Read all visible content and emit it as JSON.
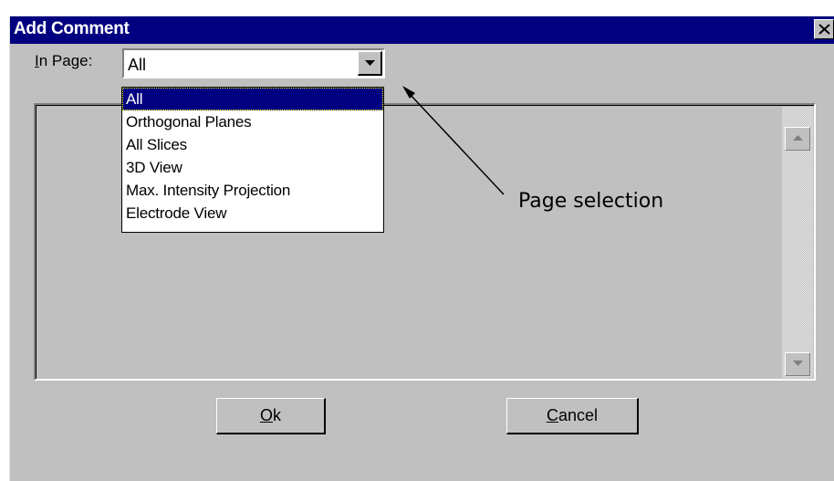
{
  "window": {
    "title": "Add Comment"
  },
  "in_page": {
    "label_prefix": "I",
    "label_rest": "n Page:",
    "selected": "All",
    "options": [
      "All",
      "Orthogonal Planes",
      "All Slices",
      "3D View",
      "Max. Intensity Projection",
      "Electrode View"
    ]
  },
  "buttons": {
    "ok_underline": "O",
    "ok_rest": "k",
    "cancel_underline": "C",
    "cancel_rest": "ancel"
  },
  "annotation": {
    "text": "Page selection"
  },
  "icons": {
    "close": "close-icon",
    "dropdown": "chevron-down-icon",
    "scroll_up": "scroll-up-icon",
    "scroll_down": "scroll-down-icon"
  },
  "colors": {
    "titlebar": "#000080",
    "face": "#c0c0c0",
    "highlight": "#000080"
  }
}
